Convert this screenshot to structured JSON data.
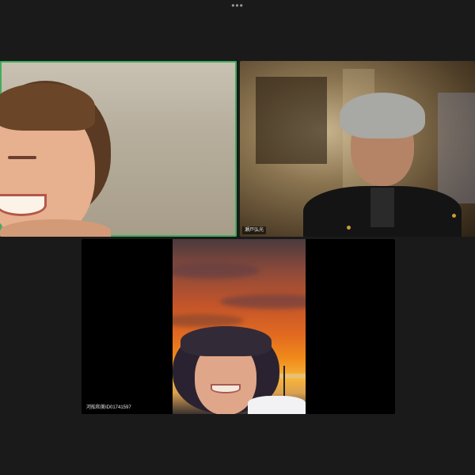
{
  "toolbar": {
    "more_icon": "more-dots-icon",
    "more_glyph": "•••"
  },
  "participants": [
    {
      "id": "p1",
      "name": "",
      "active_speaker": true,
      "accent": "#3fae5a"
    },
    {
      "id": "p2",
      "name": "瀬戸弘光",
      "active_speaker": false
    },
    {
      "id": "p3",
      "name": "河舩和美ID01741597",
      "active_speaker": false,
      "virtual_background": "sunset-sky"
    }
  ]
}
